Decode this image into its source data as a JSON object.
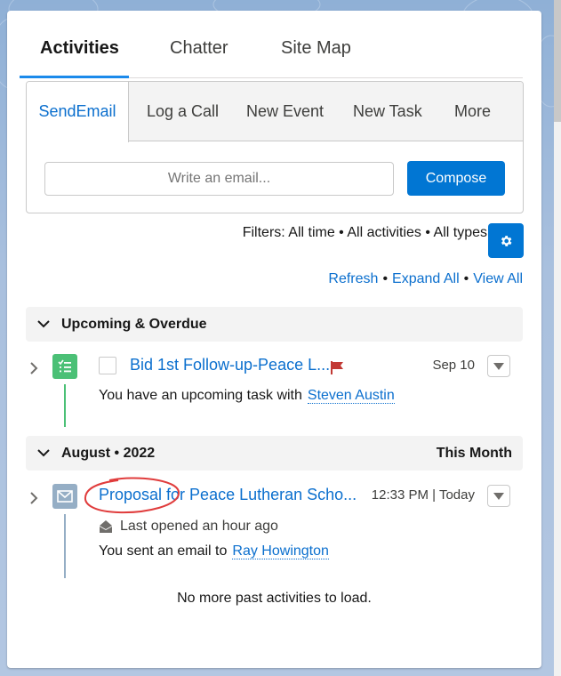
{
  "colors": {
    "brand_blue": "#0176d3",
    "link_blue": "#0b6fce",
    "tab_indicator": "#1b8aeb",
    "task_green": "#4bc076",
    "email_slate": "#95aec5",
    "flag_red": "#c23934",
    "annotation_red": "#e03c3c"
  },
  "top_tabs": [
    {
      "label": "Activities",
      "active": true
    },
    {
      "label": "Chatter",
      "active": false
    },
    {
      "label": "Site Map",
      "active": false
    }
  ],
  "publisher": {
    "tabs": [
      {
        "label": "SendEmail",
        "active": true
      },
      {
        "label": "Log a Call",
        "active": false
      },
      {
        "label": "New Event",
        "active": false
      },
      {
        "label": "New Task",
        "active": false
      },
      {
        "label": "More",
        "active": false
      }
    ],
    "email_placeholder": "Write an email...",
    "email_value": "",
    "compose_label": "Compose"
  },
  "filters": {
    "text": "Filters: All time • All activities • All types",
    "settings_icon": "gear-icon"
  },
  "actions": {
    "refresh": "Refresh",
    "expand_all": "Expand All",
    "view_all": "View All",
    "separator": "•"
  },
  "sections": [
    {
      "title": "Upcoming & Overdue",
      "right_label": "",
      "items": [
        {
          "type": "task",
          "icon": "task-icon",
          "title": "Bid 1st Follow-up-Peace L...",
          "flagged": true,
          "date": "Sep 10",
          "sub_text": "You have an upcoming task with",
          "sub_link": "Steven Austin",
          "completed": false
        }
      ]
    },
    {
      "title": "August • 2022",
      "right_label": "This Month",
      "items": [
        {
          "type": "email",
          "icon": "email-icon",
          "title": "Proposal for Peace Lutheran Scho...",
          "date": "12:33 PM | Today",
          "opened_text": "Last opened an hour ago",
          "sub_text": "You sent an email to",
          "sub_link": "Ray Howington"
        }
      ]
    }
  ],
  "footer": {
    "no_more": "No more past activities to load."
  }
}
